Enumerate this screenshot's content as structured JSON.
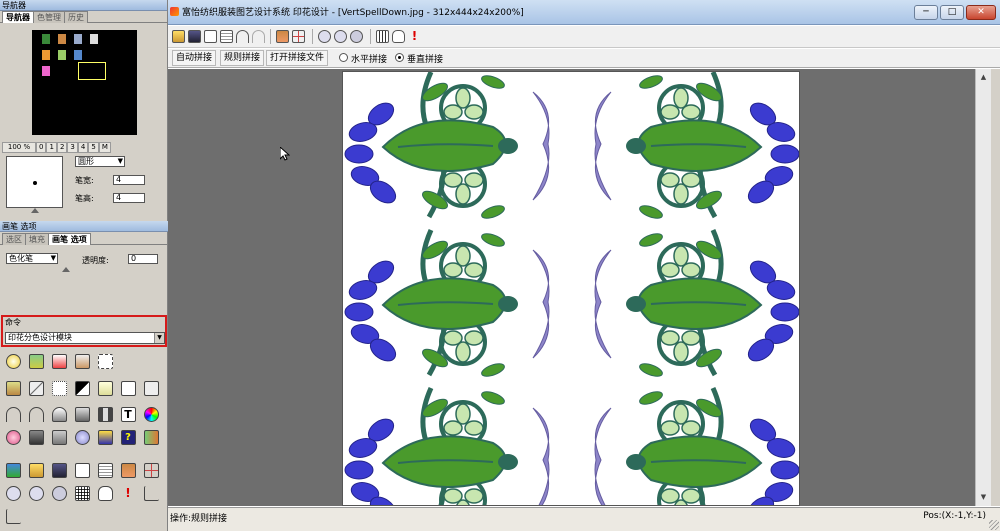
{
  "navigator": {
    "title": "导航器",
    "tabs": [
      "导航器",
      "色管理",
      "历史"
    ],
    "zoom": [
      "100 %",
      "0",
      "1",
      "2",
      "3",
      "4",
      "5",
      "M"
    ]
  },
  "brush": {
    "shape": "圆形",
    "width_label": "笔宽:",
    "width_value": "4",
    "height_label": "笔高:",
    "height_value": "4"
  },
  "brush_options": {
    "title": "画笔 选项",
    "tabs": [
      "选区",
      "填充",
      "画笔 选项"
    ],
    "tool": "色化笔",
    "opacity_label": "透明度:",
    "opacity_value": "0"
  },
  "command": {
    "title": "命令",
    "module": "印花分色设计模块"
  },
  "toolbox": {
    "row1": [
      "star-burst-icon",
      "filter-icon",
      "new-doc-icon",
      "document-icon",
      "frame-icon"
    ],
    "row2": [
      "stamp-icon",
      "pen-icon",
      "rect-select-icon",
      "color-swatch-icon",
      "copy-icon",
      "square-icon",
      "blank-icon"
    ],
    "row3": [
      "undo-arc-icon",
      "redo-arc-icon",
      "nib-icon",
      "bucket-icon",
      "brush-set-icon",
      "text-tool-icon",
      "color-wheel-icon"
    ],
    "row4": [
      "flower-icon",
      "camera-icon",
      "tools-icon",
      "disk-icon",
      "shield-icon",
      "help-icon",
      "exit-icon"
    ],
    "row5": [
      "layers-icon",
      "open-folder-icon",
      "save-icon",
      "page-icon",
      "notes-icon",
      "sheet-icon",
      "grid-frame-icon"
    ],
    "row6": [
      "zoom-in-icon",
      "zoom-out-icon",
      "zoom-fit-icon",
      "grid-icon",
      "hand-icon",
      "exclaim-icon",
      "measure-icon"
    ],
    "row7": [
      "rotate-icon"
    ]
  },
  "window": {
    "title": "富怡纺织服装图艺设计系统  印花设计 - [VertSpellDown.jpg - 312x444x24x200%]",
    "min": "─",
    "max": "□",
    "close": "✕"
  },
  "toolbar2": {
    "auto": "自动拼接",
    "regular": "规则拼接",
    "open": "打开拼接文件",
    "horizontal": "水平拼接",
    "vertical": "垂直拼接"
  },
  "status": {
    "left": "操作:规则拼接",
    "right": "Pos:(X:-1,Y:-1)"
  },
  "colors": {
    "leaf_green": "#4a9a2c",
    "petal_blue": "#3b3bd0",
    "stem_teal": "#2d6a5a",
    "motif_lavender": "#7a70c0",
    "highlight_red": "#d61a1a"
  }
}
